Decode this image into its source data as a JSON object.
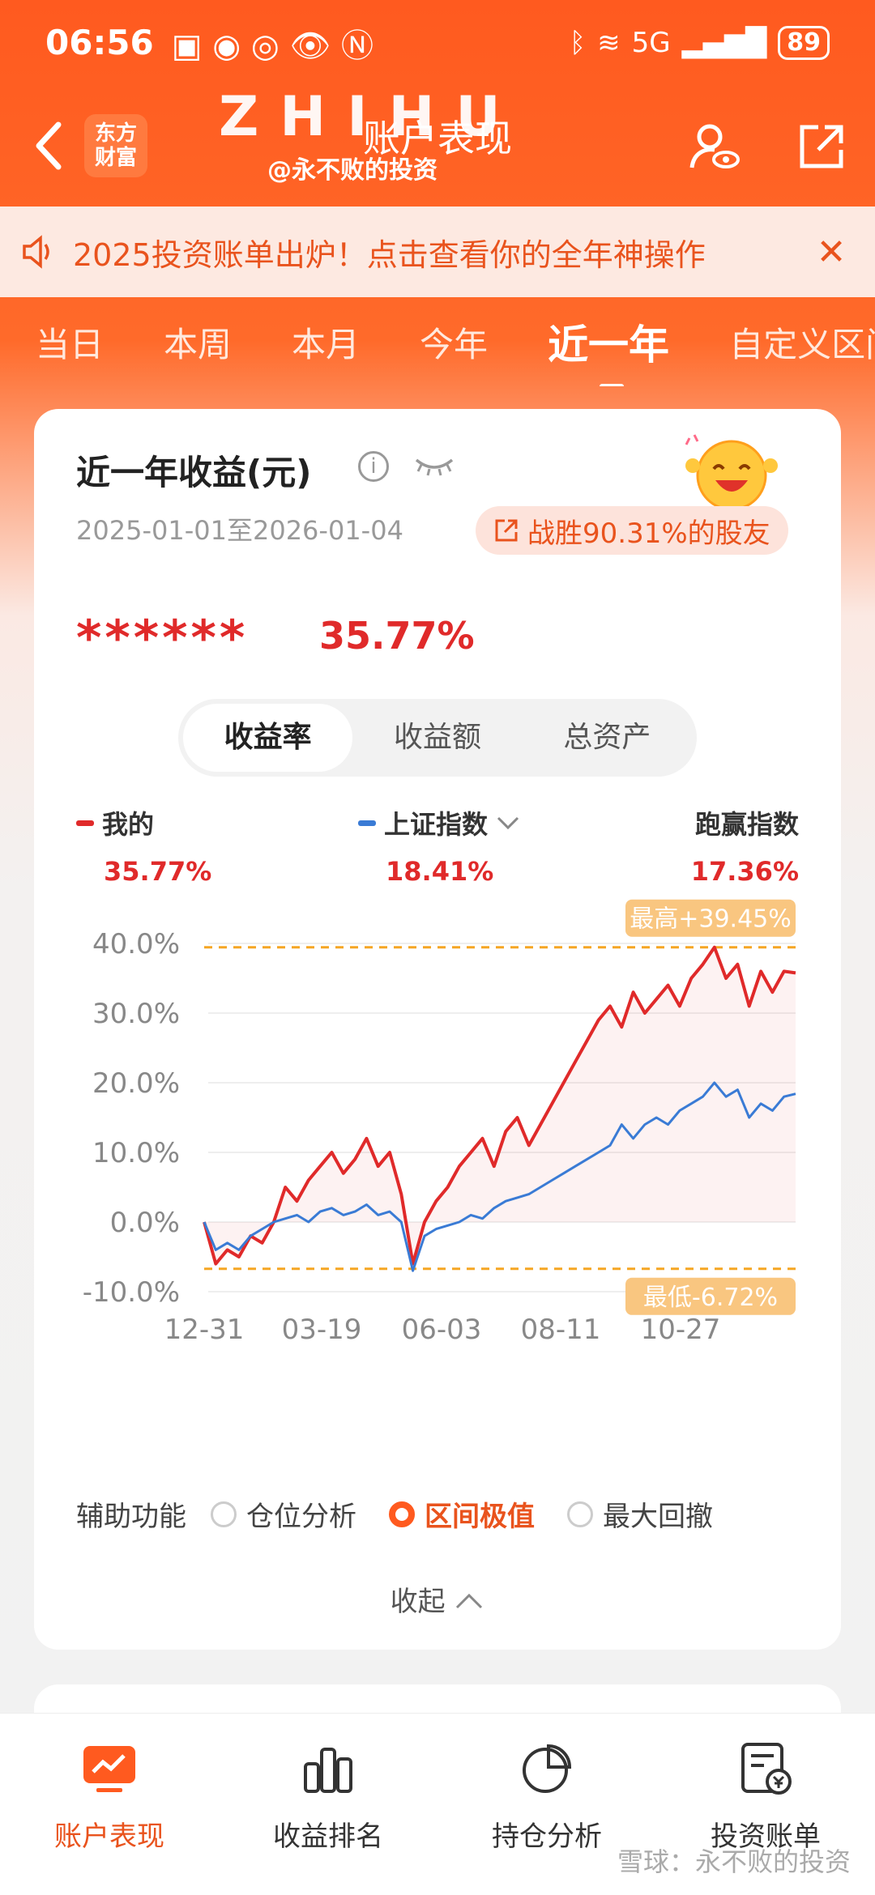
{
  "status_bar": {
    "time": "06:56",
    "battery": "89",
    "network": "5G"
  },
  "nav": {
    "brand_logo": "东方\n财富",
    "title": "账户表现",
    "watermark": "ZHIHU",
    "watermark_sub": "@永不败的投资"
  },
  "notice": {
    "text": "2025投资账单出炉！点击查看你的全年神操作",
    "close": "✕"
  },
  "period_tabs": [
    "当日",
    "本周",
    "本月",
    "今年",
    "近一年",
    "自定义区间"
  ],
  "active_period": "近一年",
  "card": {
    "title": "近一年收益(元)",
    "info": "i",
    "date_range": "2025-01-01至2026-01-04",
    "beat_text": "战胜90.31%的股友",
    "masked_amount": "******",
    "total_return": "35.77%",
    "segments": [
      "收益率",
      "收益额",
      "总资产"
    ],
    "active_segment": "收益率",
    "legend": [
      {
        "name": "我的",
        "value": "35.77%",
        "color": "#e02a2a"
      },
      {
        "name": "上证指数",
        "value": "18.41%",
        "color": "#3a7bd5"
      },
      {
        "name": "跑赢指数",
        "value": "17.36%"
      }
    ],
    "aux_label": "辅助功能",
    "aux_options": [
      "仓位分析",
      "区间极值",
      "最大回撤"
    ],
    "active_aux": "区间极值",
    "collapse": "收起"
  },
  "chart_data": {
    "type": "line",
    "y_ticks": [
      "40.0%",
      "30.0%",
      "20.0%",
      "10.0%",
      "0.0%",
      "-10.0%"
    ],
    "x_ticks": [
      "12-31",
      "03-19",
      "06-03",
      "08-11",
      "10-27"
    ],
    "ylim": [
      -10,
      40
    ],
    "max_label": "最高+39.45%",
    "min_label": "最低-6.72%",
    "max_value": 39.45,
    "min_value": -6.72,
    "series": [
      {
        "name": "我的",
        "color": "#e02a2a",
        "values": [
          0,
          -6,
          -4,
          -5,
          -2,
          -3,
          0,
          5,
          3,
          6,
          8,
          10,
          7,
          9,
          12,
          8,
          10,
          4,
          -6,
          0,
          3,
          5,
          8,
          10,
          12,
          8,
          13,
          15,
          11,
          14,
          17,
          20,
          23,
          26,
          29,
          31,
          28,
          33,
          30,
          32,
          34,
          31,
          35,
          37,
          39.45,
          35,
          37,
          31,
          36,
          33,
          36,
          35.77
        ]
      },
      {
        "name": "上证指数",
        "color": "#3a7bd5",
        "values": [
          0,
          -4,
          -3,
          -4,
          -2,
          -1,
          0,
          0.5,
          1,
          0,
          1.5,
          2,
          1,
          1.5,
          2.5,
          1,
          1.5,
          0,
          -7,
          -2,
          -1,
          -0.5,
          0,
          1,
          0.5,
          2,
          3,
          3.5,
          4,
          5,
          6,
          7,
          8,
          9,
          10,
          11,
          14,
          12,
          14,
          15,
          14,
          16,
          17,
          18,
          20,
          18,
          19,
          15,
          17,
          16,
          18,
          18.41
        ]
      }
    ]
  },
  "bottom_nav": [
    {
      "label": "账户表现",
      "icon": "trend-icon"
    },
    {
      "label": "收益排名",
      "icon": "bar-chart-icon"
    },
    {
      "label": "持仓分析",
      "icon": "pie-chart-icon"
    },
    {
      "label": "投资账单",
      "icon": "bill-icon"
    }
  ],
  "active_tab": "账户表现",
  "bottom_watermark": "雪球：永不败的投资",
  "colors": {
    "brand": "#ff5a1f",
    "up": "#e02a2a",
    "index": "#3a7bd5",
    "accent": "#f5a623"
  }
}
